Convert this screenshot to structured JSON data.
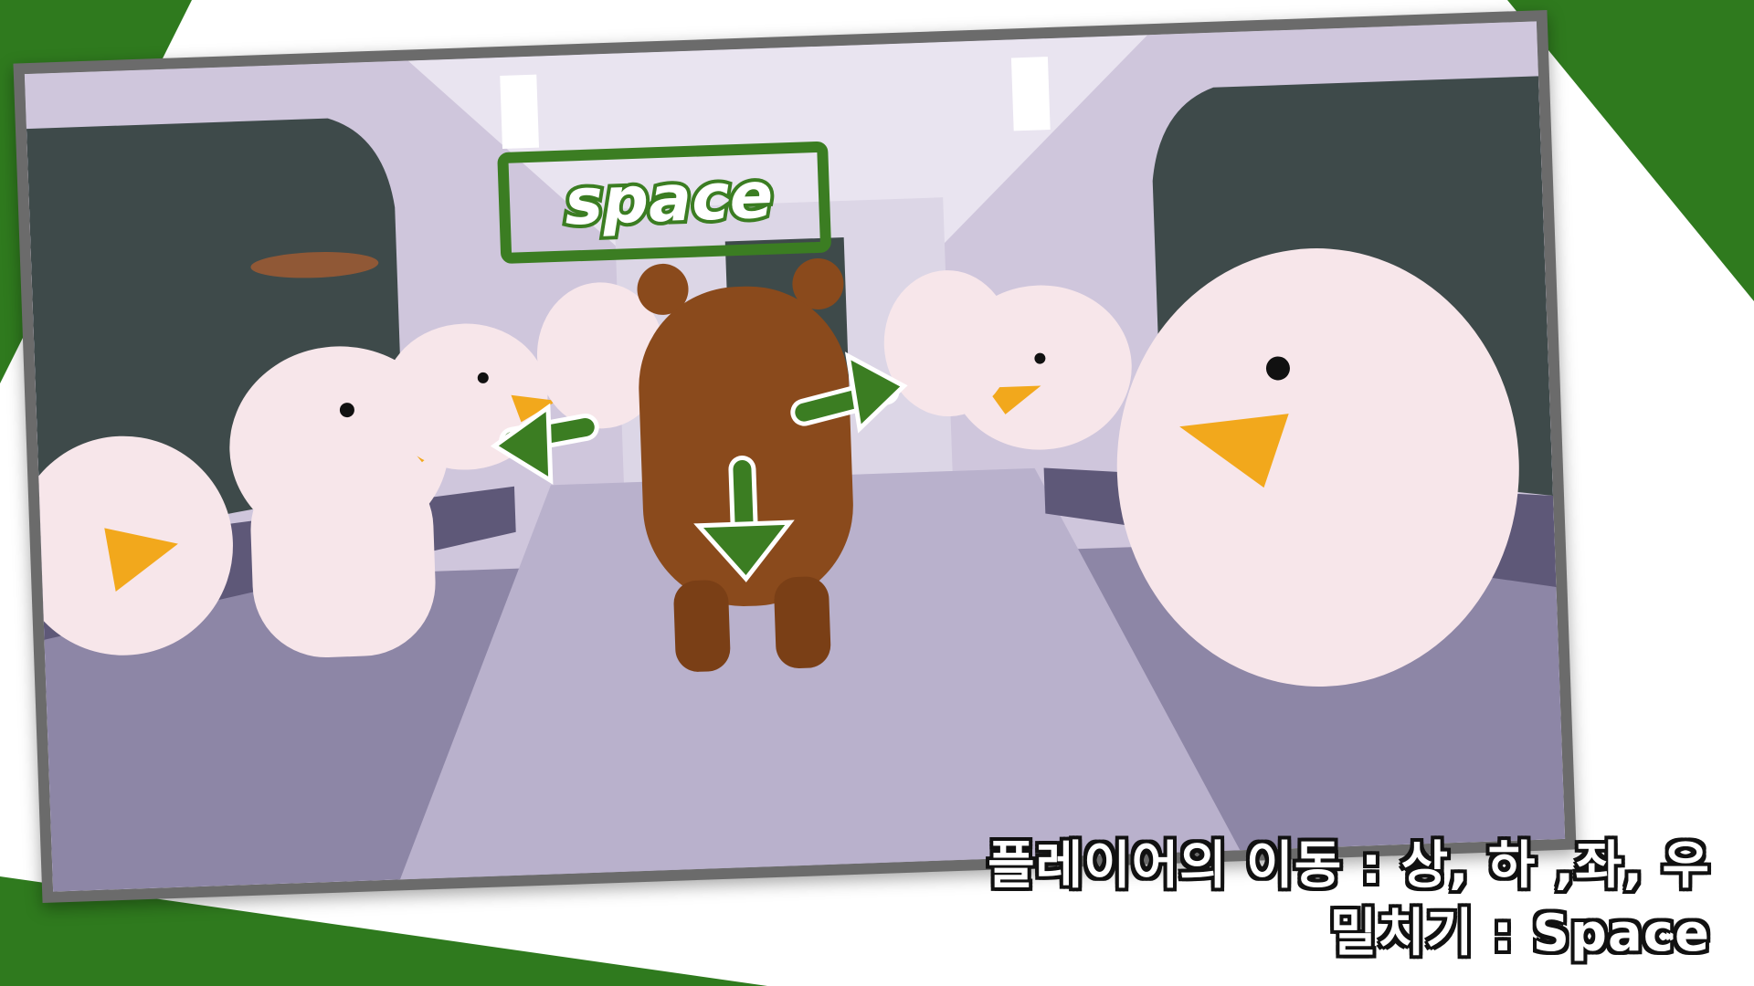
{
  "scene": {
    "space_label": "space"
  },
  "caption": {
    "line1": "플레이어의 이동 : 상, 하 ,좌, 우",
    "line2": "밀치기 : Space"
  },
  "colors": {
    "accent_green": "#2e7d1a",
    "arrow_green": "#3b7d22",
    "bear_brown": "#8a4a1c",
    "duck_white": "#f7e6ea",
    "beak_orange": "#f2a81c"
  },
  "icons": {
    "arrow_left": "arrow-left-icon",
    "arrow_right": "arrow-right-icon",
    "arrow_down": "arrow-down-icon"
  }
}
